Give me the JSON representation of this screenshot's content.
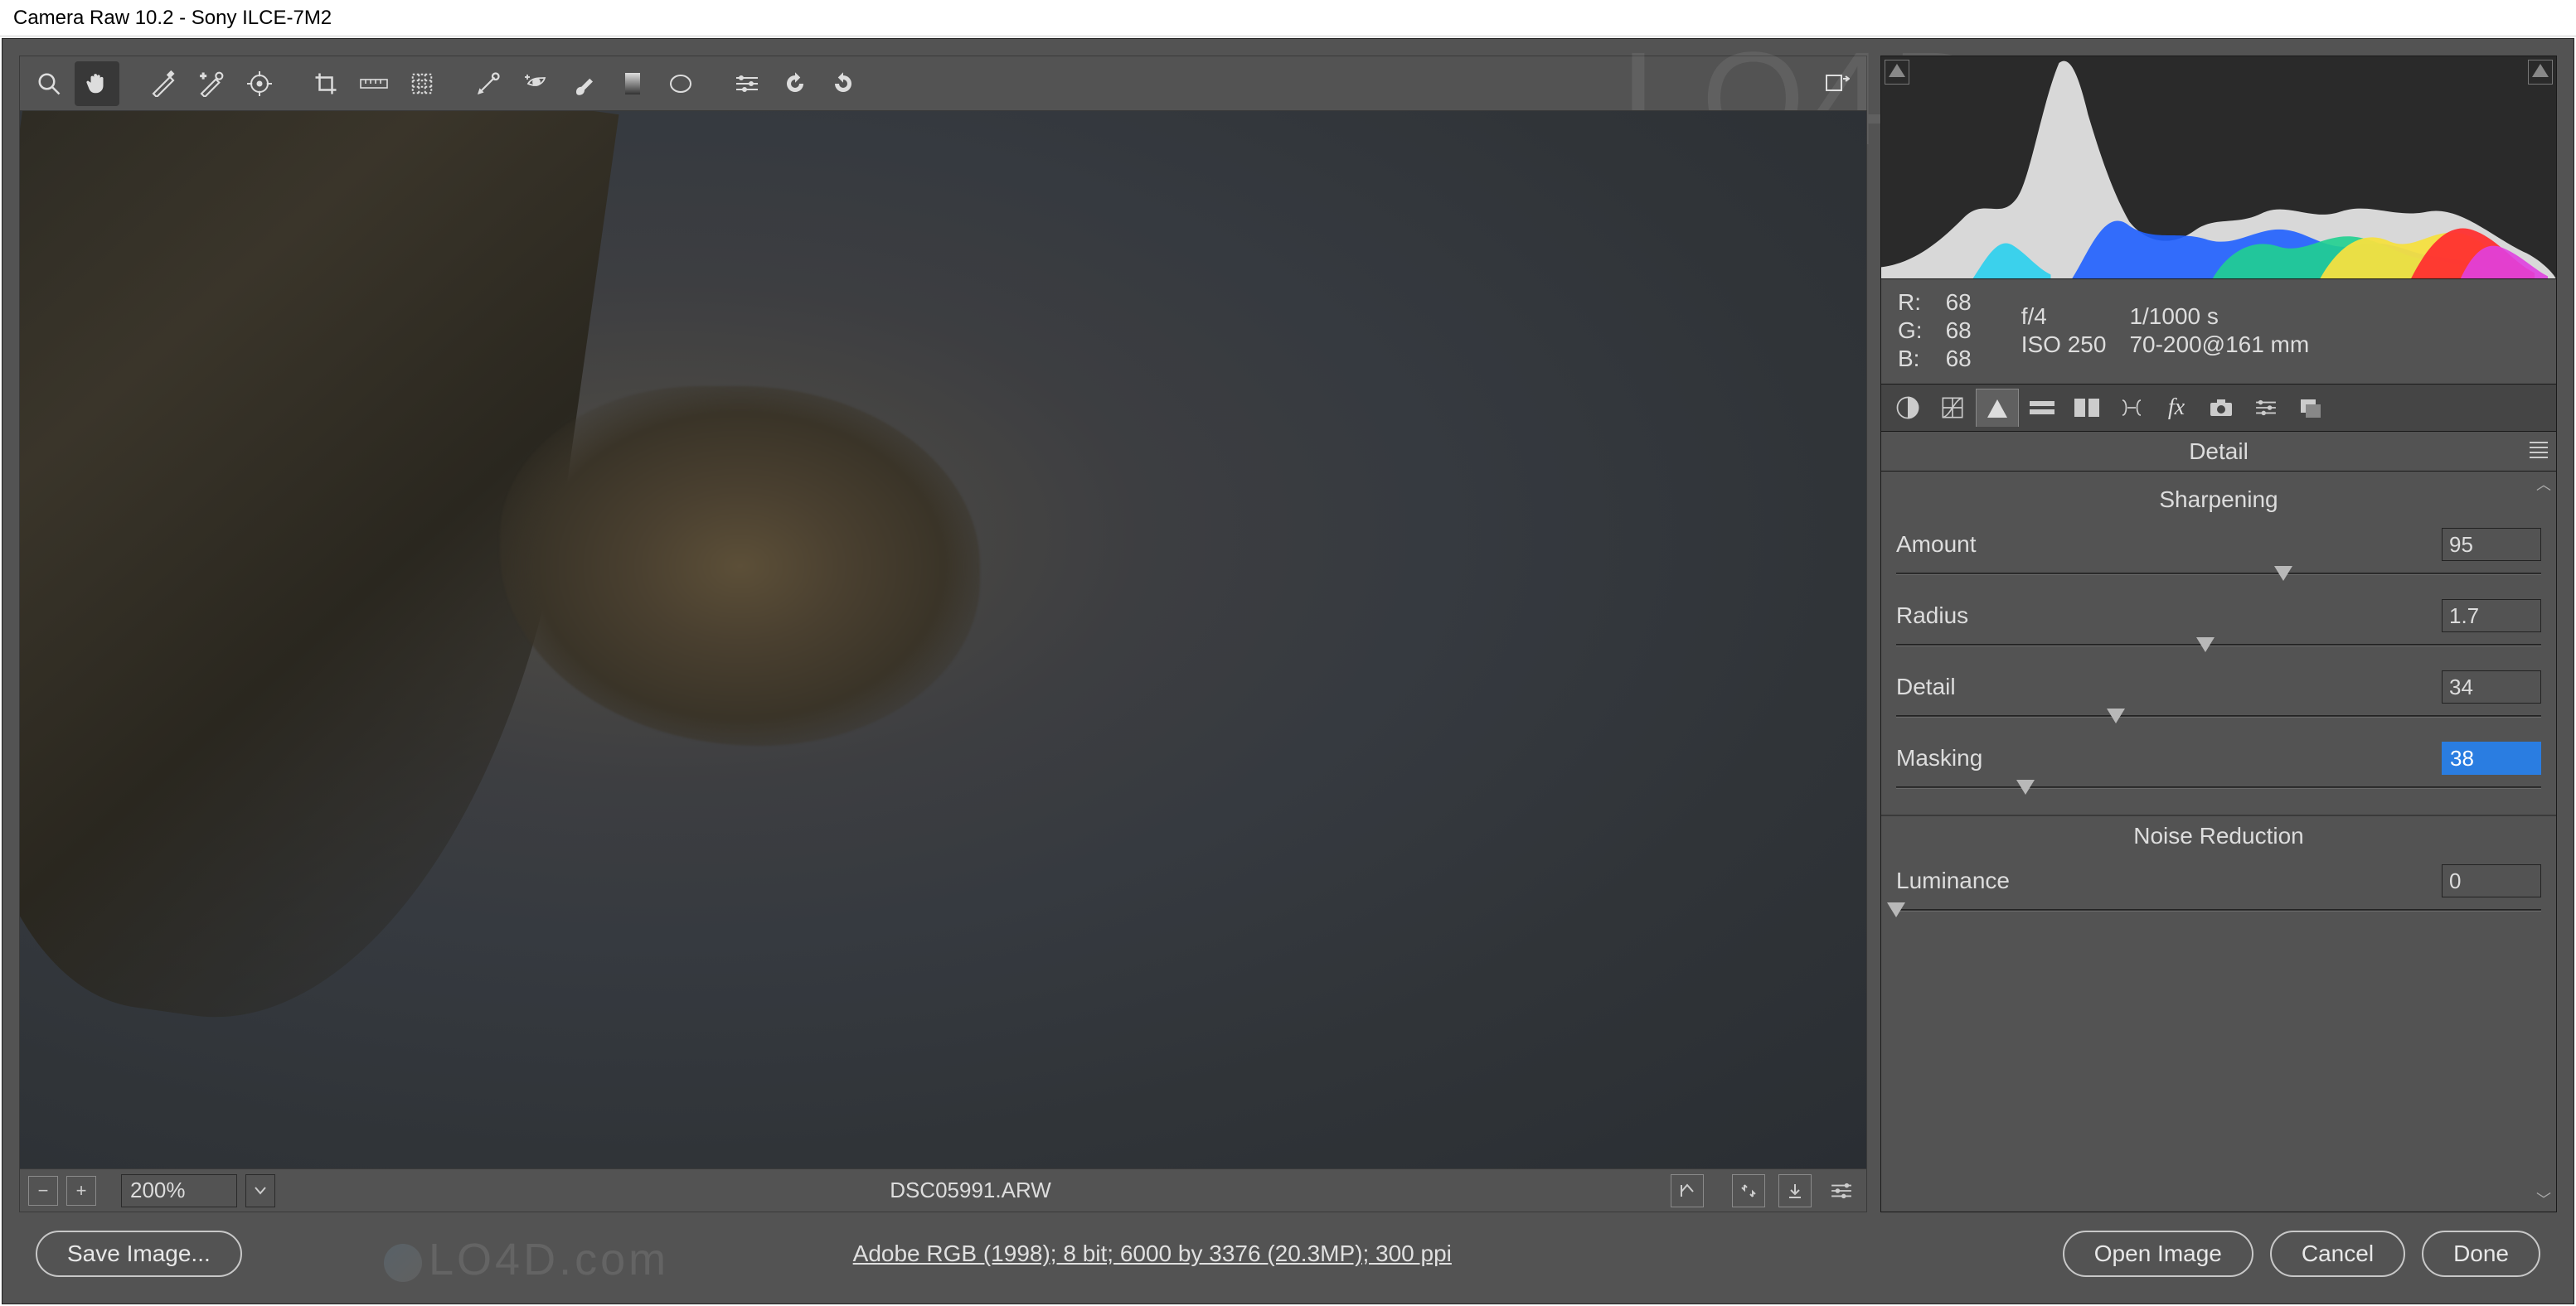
{
  "window": {
    "title": "Camera Raw 10.2  -  Sony ILCE-7M2"
  },
  "toolbar": {
    "tools": [
      {
        "id": "zoom",
        "name": "zoom-tool-icon"
      },
      {
        "id": "hand",
        "name": "hand-tool-icon",
        "active": true
      },
      {
        "id": "wb",
        "name": "white-balance-tool-icon"
      },
      {
        "id": "color",
        "name": "color-sampler-tool-icon"
      },
      {
        "id": "target",
        "name": "targeted-adjustment-tool-icon"
      },
      {
        "id": "crop",
        "name": "crop-tool-icon"
      },
      {
        "id": "straighten",
        "name": "straighten-tool-icon"
      },
      {
        "id": "transform",
        "name": "transform-tool-icon"
      },
      {
        "id": "spot",
        "name": "spot-removal-tool-icon"
      },
      {
        "id": "redeye",
        "name": "red-eye-tool-icon"
      },
      {
        "id": "brush",
        "name": "adjustment-brush-tool-icon"
      },
      {
        "id": "grad",
        "name": "graduated-filter-tool-icon"
      },
      {
        "id": "radial",
        "name": "radial-filter-tool-icon"
      },
      {
        "id": "prefs",
        "name": "preferences-icon"
      },
      {
        "id": "ccw",
        "name": "rotate-ccw-icon"
      },
      {
        "id": "cw",
        "name": "rotate-cw-icon"
      }
    ]
  },
  "status": {
    "zoom": "200%",
    "filename": "DSC05991.ARW"
  },
  "exif": {
    "r_label": "R:",
    "r": "68",
    "g_label": "G:",
    "g": "68",
    "b_label": "B:",
    "b": "68",
    "aperture": "f/4",
    "shutter": "1/1000 s",
    "iso": "ISO 250",
    "lens": "70-200@161 mm"
  },
  "panel": {
    "title": "Detail",
    "sections": {
      "sharpening": {
        "heading": "Sharpening",
        "amount": {
          "label": "Amount",
          "value": "95",
          "pos": 60
        },
        "radius": {
          "label": "Radius",
          "value": "1.7",
          "pos": 48
        },
        "detail": {
          "label": "Detail",
          "value": "34",
          "pos": 34
        },
        "masking": {
          "label": "Masking",
          "value": "38",
          "pos": 20
        }
      },
      "noise": {
        "heading": "Noise Reduction",
        "luminance": {
          "label": "Luminance",
          "value": "0",
          "pos": 0
        }
      }
    }
  },
  "footer": {
    "save": "Save Image...",
    "meta": "Adobe RGB (1998); 8 bit; 6000 by 3376 (20.3MP); 300 ppi",
    "open": "Open Image",
    "cancel": "Cancel",
    "done": "Done"
  },
  "chart_data": {
    "type": "area",
    "title": "Histogram",
    "xlabel": "",
    "ylabel": "",
    "xlim": [
      0,
      255
    ],
    "ylim": [
      0,
      100
    ],
    "series": [
      {
        "name": "luminance",
        "color": "#d8d8d8"
      },
      {
        "name": "red",
        "color": "#ff3030"
      },
      {
        "name": "green",
        "color": "#20e020"
      },
      {
        "name": "blue",
        "color": "#3060ff"
      },
      {
        "name": "yellow",
        "color": "#f5e040"
      },
      {
        "name": "cyan",
        "color": "#20d0d0"
      },
      {
        "name": "magenta",
        "color": "#e040e0"
      }
    ],
    "note": "Shape shows dominant mid-dark peak around x≈65 reaching ~98% with secondary broad region 110–220 at ~25–40%."
  }
}
